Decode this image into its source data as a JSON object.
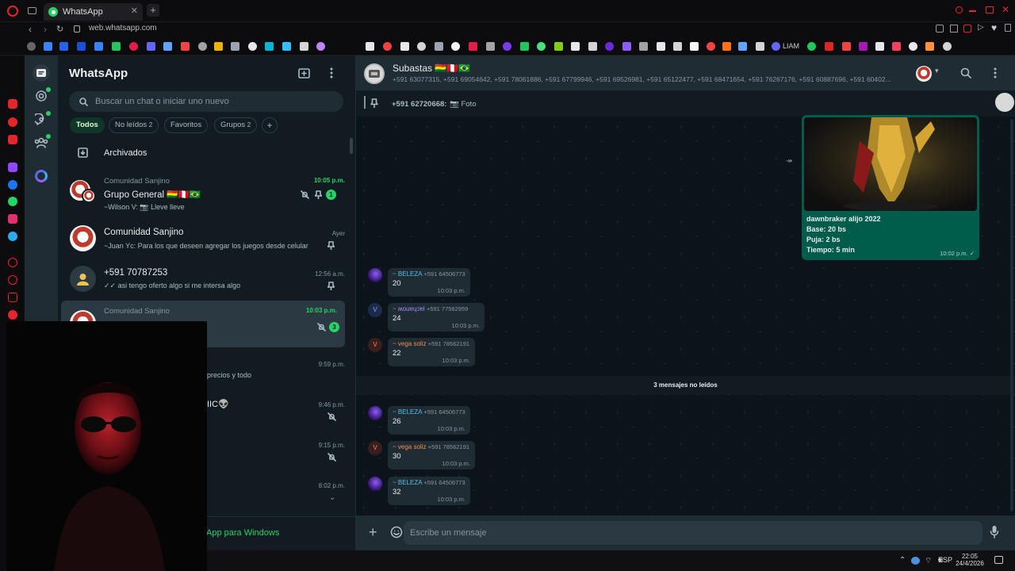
{
  "browser": {
    "tab_title": "WhatsApp",
    "url": "web.whatsapp.com",
    "bookmark_label": "LIAM"
  },
  "sidebar": {
    "app_title": "WhatsApp",
    "search_placeholder": "Buscar un chat o iniciar uno nuevo",
    "filters": [
      {
        "label": "Todos"
      },
      {
        "label": "No leídos",
        "count": "2"
      },
      {
        "label": "Favoritos"
      },
      {
        "label": "Grupos",
        "count": "2"
      }
    ],
    "archived_label": "Archivados",
    "chats": [
      {
        "group": "Comunidad Sanjino",
        "name": "Grupo General 🇧🇴🇵🇪🇧🇷",
        "preview": "~Wilson V: 📷 Lleve lleve",
        "time": "10:05 p.m.",
        "badge": "1"
      },
      {
        "name": "Comunidad Sanjino",
        "preview": "~Juan Yc: Para los que deseen agregar los juegos desde celular",
        "time": "Ayer"
      },
      {
        "name": "+591 70787253",
        "preview": "✓✓ asi tengo oferto algo si me intersa algo",
        "time": "12:56 a.m."
      },
      {
        "group": "Comunidad Sanjino",
        "name": "",
        "preview": "",
        "time": "10:03 p.m.",
        "badge": "3"
      },
      {
        "name": "",
        "preview": "precios y todo",
        "time": "9:59 p.m."
      },
      {
        "name": "IIC👽",
        "preview": "",
        "time": "9:46 p.m."
      },
      {
        "name": "",
        "preview": "",
        "time": "9:15 p.m."
      },
      {
        "name": "",
        "preview": "",
        "time": "8:02 p.m."
      }
    ],
    "windows_app_promo": "App para Windows"
  },
  "conversation": {
    "title": "Subastas 🇧🇴🇵🇪🇧🇷",
    "members": "+591 63077315, +591 69054642, +591 78061886, +591 67799946, +591 69526981, +591 65122477, +591 68471654, +591 76267176, +591 60887696, +591 60402...",
    "pinned_sender": "+591 62720668:",
    "pinned_text": "📷 Foto",
    "outgoing": {
      "title": "dawnbraker alijo 2022",
      "line1": "Base: 20 bs",
      "line2": "Puja: 2 bs",
      "line3": "Tiempo: 5 min",
      "time": "10:02 p.m. ✓"
    },
    "messages": [
      {
        "author": "~ BELEZA",
        "phone": "+591 64506773",
        "body": "20",
        "time": "10:03 p.m.",
        "color": "#53bdeb"
      },
      {
        "author": "~ ʍouɐɥɔɐl",
        "phone": "+591 77582959",
        "body": "24",
        "time": "10:03 p.m.",
        "color": "#a78bfa"
      },
      {
        "author": "~ vega soliz",
        "phone": "+591 78562191",
        "body": "22",
        "time": "10:03 p.m.",
        "color": "#f28b50"
      }
    ],
    "unread_divider": "3 mensajes no leídos",
    "messages_after": [
      {
        "author": "~ BELEZA",
        "phone": "+591 64506773",
        "body": "26",
        "time": "10:03 p.m.",
        "color": "#53bdeb"
      },
      {
        "author": "~ vega soliz",
        "phone": "+591 78562191",
        "body": "30",
        "time": "10:03 p.m.",
        "color": "#f28b50"
      },
      {
        "author": "~ BELEZA",
        "phone": "+591 64506773",
        "body": "32",
        "time": "10:03 p.m.",
        "color": "#53bdeb"
      }
    ],
    "composer_placeholder": "Escribe un mensaje"
  },
  "taskbar": {
    "lang": "ESP",
    "time": "22:05",
    "date": "24/4/2026"
  },
  "colors": {
    "accent": "#25d366",
    "panel": "#111b21",
    "header": "#202c33",
    "outgoing_bubble": "#005c4b",
    "chat_bg": "#0b141a"
  }
}
